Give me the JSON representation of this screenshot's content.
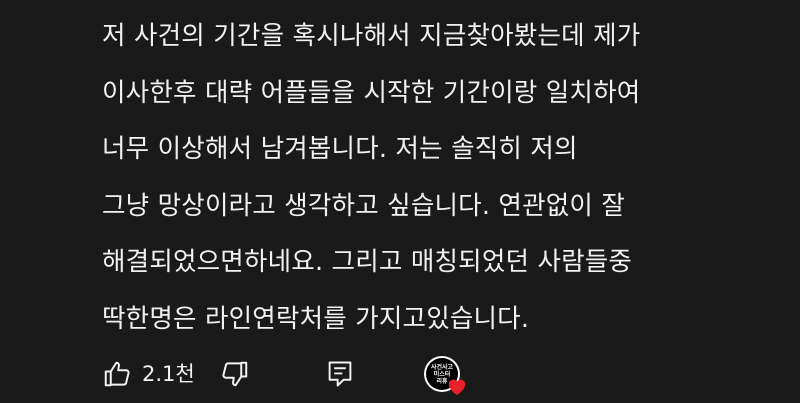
{
  "comment": {
    "lines": [
      "저 사건의 기간을 혹시나해서 지금찾아봤는데 제가",
      "이사한후 대략 어플들을 시작한 기간이랑 일치하여",
      "너무 이상해서 남겨봅니다. 저는 솔직히 저의",
      "그냥 망상이라고 생각하고 싶습니다. 연관없이 잘",
      "해결되었으면하네요. 그리고 매칭되었던 사람들중",
      "딱한명은 라인연락처를 가지고있습니다."
    ]
  },
  "actions": {
    "like_count": "2.1천",
    "like_icon": "thumbs-up-icon",
    "dislike_icon": "thumbs-down-icon",
    "reply_icon": "reply-comment-icon"
  },
  "creator_heart": {
    "avatar_text": "사건사고 미스터 리휴",
    "heart_color": "#e8202a"
  },
  "colors": {
    "background": "#1a1a1a",
    "text": "#f1f1f1",
    "heart": "#e8202a"
  }
}
